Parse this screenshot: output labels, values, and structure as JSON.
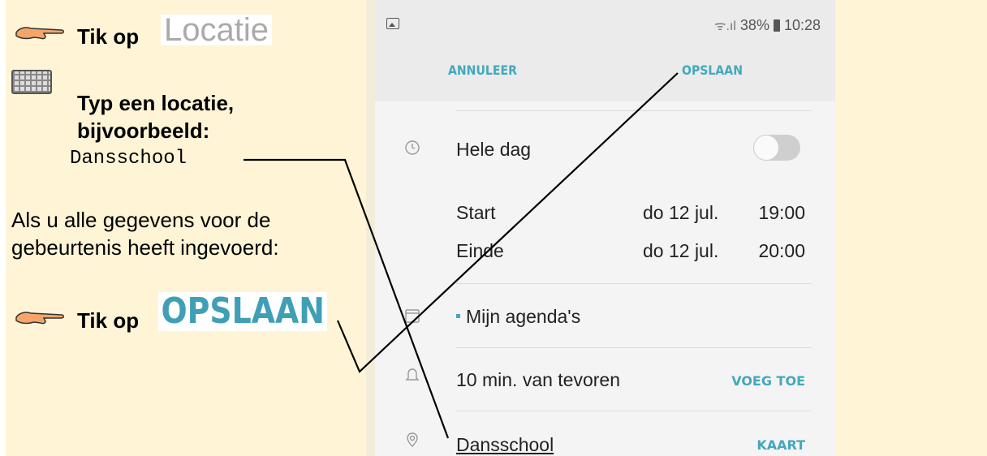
{
  "instructions": {
    "step1_text": "Tik op",
    "step1_sample": "Locatie",
    "step2_line1": "Typ een locatie,",
    "step2_line2": "bijvoorbeeld:",
    "step2_example": "Dansschool",
    "note_line1": "Als u alle gegevens voor de",
    "note_line2": "gebeurtenis heeft ingevoerd:",
    "step3_text": "Tik op",
    "step3_sample": "OPSLAAN"
  },
  "status_bar": {
    "battery": "38%",
    "time": "10:28",
    "signal": "ᯤ.ıl"
  },
  "header": {
    "cancel_label": "ANNULEER",
    "save_label": "OPSLAAN"
  },
  "event": {
    "all_day_label": "Hele dag",
    "start_label": "Start",
    "start_date": "do 12 jul.",
    "start_time": "19:00",
    "end_label": "Einde",
    "end_date": "do 12 jul.",
    "end_time": "20:00",
    "calendar_label": "Mijn agenda's",
    "reminder_label": "10 min. van tevoren",
    "reminder_action": "VOEG TOE",
    "location_value": "Dansschool",
    "location_action": "KAART"
  },
  "colors": {
    "accent": "#43a8bc",
    "instruction_bg": "#fff4d6",
    "phone_bg": "#f4f4f4"
  }
}
